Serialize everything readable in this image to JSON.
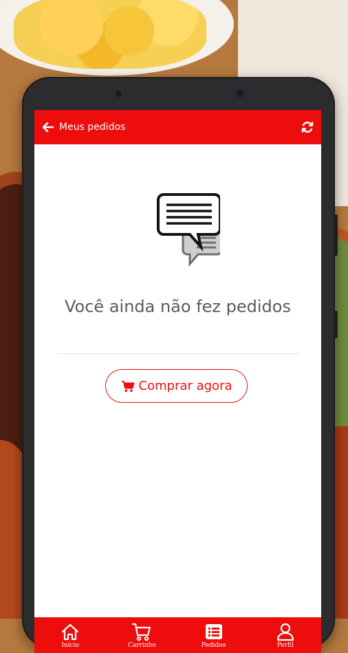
{
  "header": {
    "title": "Meus pedidos"
  },
  "empty_state": {
    "message": "Você ainda não fez pedidos",
    "button_label": "Comprar agora"
  },
  "bottom_nav": {
    "items": [
      {
        "label": "Início",
        "icon": "home-icon"
      },
      {
        "label": "Carrinho",
        "icon": "cart-icon"
      },
      {
        "label": "Pedidos",
        "icon": "orders-icon",
        "active": true
      },
      {
        "label": "Perfil",
        "icon": "user-icon"
      }
    ]
  },
  "colors": {
    "primary": "#ed0d0d",
    "text": "#5b5b5b"
  }
}
